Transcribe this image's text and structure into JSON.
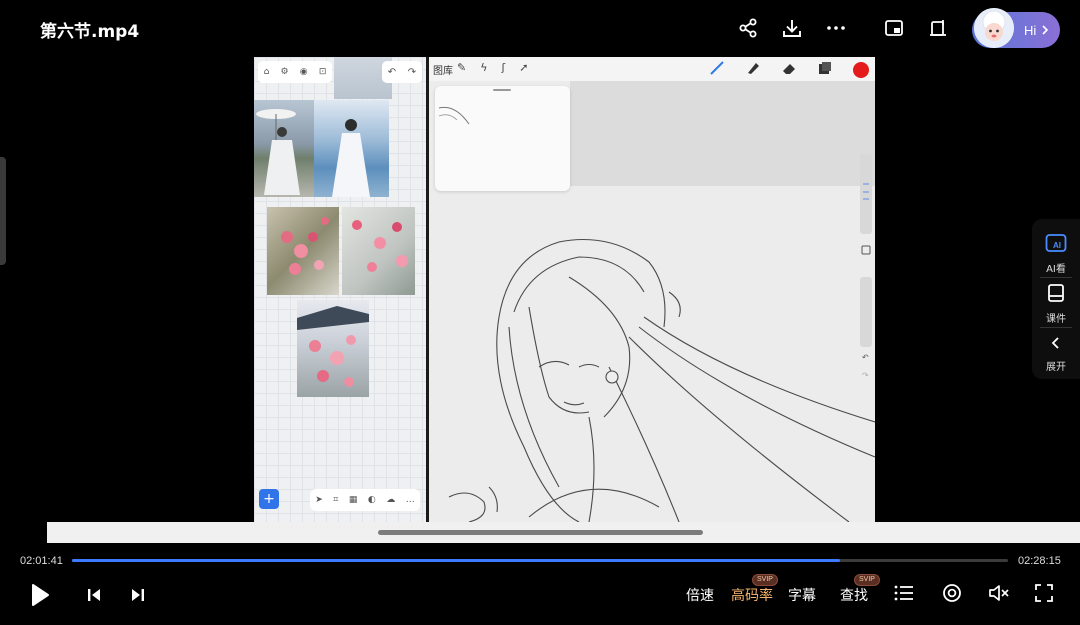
{
  "topbar": {
    "title": "第六节.mp4",
    "hi_label": "Hi",
    "icons": [
      "share-icon",
      "download-icon",
      "more-icon",
      "picture-in-picture-icon",
      "pin-window-icon"
    ]
  },
  "reference_board": {
    "toolbar_icons": [
      "home-icon",
      "settings-icon",
      "eye-icon",
      "lock-icon"
    ],
    "undo_icons": [
      "undo-icon",
      "redo-icon"
    ],
    "add_label": "+"
  },
  "procreate": {
    "gallery_label": "图库",
    "brush_color": "#e51b1b"
  },
  "side_panel": {
    "items": [
      {
        "label": "AI看",
        "icon": "ai-view-icon"
      },
      {
        "label": "课件",
        "icon": "courseware-icon"
      },
      {
        "label": "展开",
        "icon": "chevron-left-icon"
      }
    ]
  },
  "player": {
    "current_time": "02:01:41",
    "total_time": "02:28:15",
    "progress": 0.8205,
    "speed_label": "倍速",
    "quality_label": "高码率",
    "quality_badge": "SVIP",
    "subtitle_label": "字幕",
    "search_label": "查找",
    "search_badge": "SVIP",
    "accent_color": "#3a7bff"
  }
}
